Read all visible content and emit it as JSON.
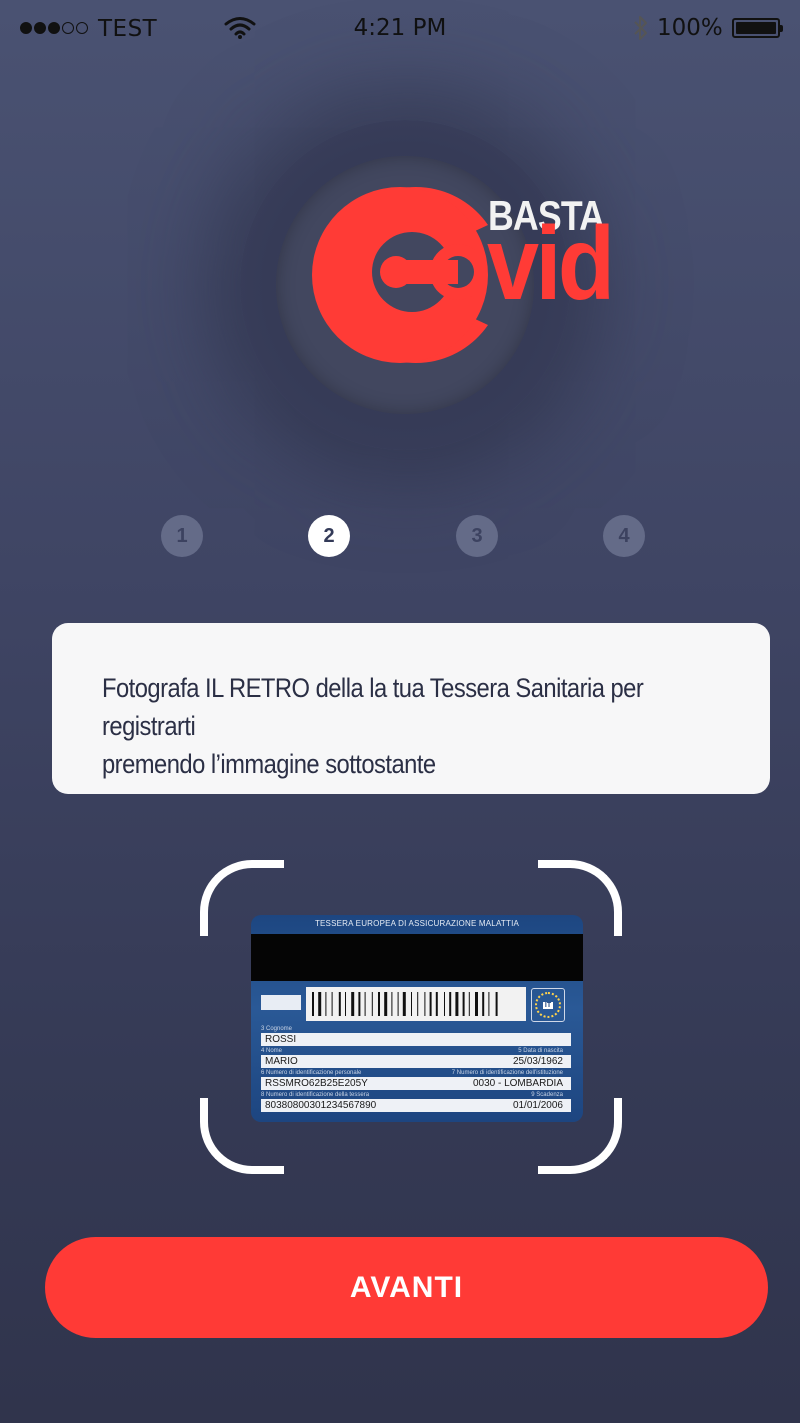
{
  "status_bar": {
    "carrier": "TEST",
    "time": "4:21 PM",
    "battery": "100%",
    "signal_bars": 3,
    "signal_total": 5
  },
  "logo": {
    "basta": "BASTA",
    "vid": "vid",
    "colors": {
      "red": "#ff3b36",
      "white": "#f2f2f2"
    }
  },
  "steps": [
    "1",
    "2",
    "3",
    "4"
  ],
  "active_step": 2,
  "instruction": {
    "line1": "Fotografa IL RETRO della la tua Tessera Sanitaria per registrarti",
    "line2": "premendo l’immagine sottostante"
  },
  "health_card": {
    "title": "TESSERA EUROPEA DI ASSICURAZIONE MALATTIA",
    "country_code": "IT",
    "surname_label": "3 Cognome",
    "surname": "ROSSI",
    "name_label": "4 Nome",
    "birth_label": "5 Data di nascita",
    "name": "MARIO",
    "birth_date": "25/03/1962",
    "personal_id_label": "6 Numero di identificazione personale",
    "institution_label": "7 Numero di identificazione dell'istituzione",
    "personal_id": "RSSMRO62B25E205Y",
    "institution": "0030 - LOMBARDIA",
    "card_id_label": "8 Numero di identificazione della tessera",
    "expiry_label": "9 Scadenza",
    "card_id": "80380800301234567890",
    "expiry": "01/01/2006"
  },
  "button": {
    "label": "AVANTI"
  },
  "colors": {
    "accent": "#ff3a36",
    "background_top": "#4a5272",
    "background_bottom": "#30344c"
  }
}
